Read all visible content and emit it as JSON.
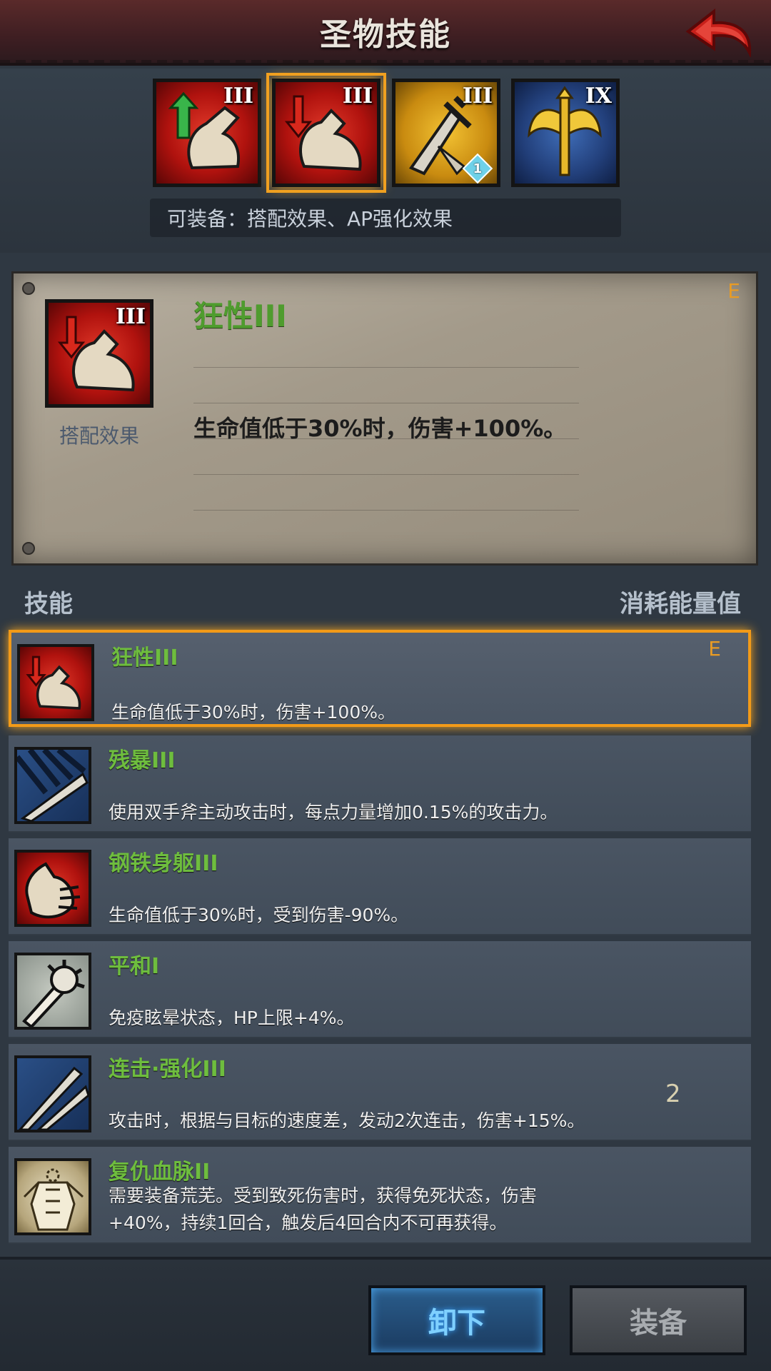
{
  "header": {
    "title": "圣物技能"
  },
  "top_icons": [
    {
      "level": "III",
      "theme": "red",
      "icon": "arm-arrow-up-icon"
    },
    {
      "level": "III",
      "theme": "red",
      "icon": "arm-arrow-down-icon",
      "selected": true
    },
    {
      "level": "III",
      "theme": "gold",
      "icon": "sword-shatter-icon",
      "badge": "1"
    },
    {
      "level": "IX",
      "theme": "blue",
      "icon": "golden-axe-icon"
    }
  ],
  "equip_note": "可装备：搭配效果、AP强化效果",
  "detail": {
    "level": "III",
    "type_label": "搭配效果",
    "name": "狂性III",
    "grade": "E",
    "description": "生命值低于30%时，伤害+100%。"
  },
  "list_header": {
    "left": "技能",
    "right": "消耗能量值"
  },
  "skills": [
    {
      "name": "狂性III",
      "desc": "生命值低于30%时，伤害+100%。",
      "grade": "E",
      "cost": "",
      "selected": true,
      "icon": "arm-arrow-down-icon"
    },
    {
      "name": "残暴III",
      "desc": "使用双手斧主动攻击时，每点力量增加0.15%的攻击力。",
      "grade": "",
      "cost": "",
      "icon": "claw-slash-icon"
    },
    {
      "name": "钢铁身躯III",
      "desc": "生命值低于30%时，受到伤害-90%。",
      "grade": "",
      "cost": "",
      "icon": "fist-shield-icon"
    },
    {
      "name": "平和I",
      "desc": "免疫眩晕状态，HP上限+4%。",
      "grade": "",
      "cost": "",
      "icon": "spiked-club-icon"
    },
    {
      "name": "连击·强化III",
      "desc": "攻击时，根据与目标的速度差，发动2次连击，伤害+15%。",
      "grade": "",
      "cost": "2",
      "icon": "twin-blades-icon"
    },
    {
      "name": "复仇血脉II",
      "desc": "需要装备荒芜。受到致死伤害时，获得免死状态，伤害+40%，持续1回合，触发后4回合内不可再获得。",
      "grade": "",
      "cost": "",
      "icon": "headless-warrior-icon"
    }
  ],
  "buttons": {
    "unequip": "卸下",
    "equip": "装备"
  },
  "colors": {
    "accent": "#f29a18",
    "skill_name": "#6ebd3e",
    "unequip_text": "#7fd0ff"
  }
}
